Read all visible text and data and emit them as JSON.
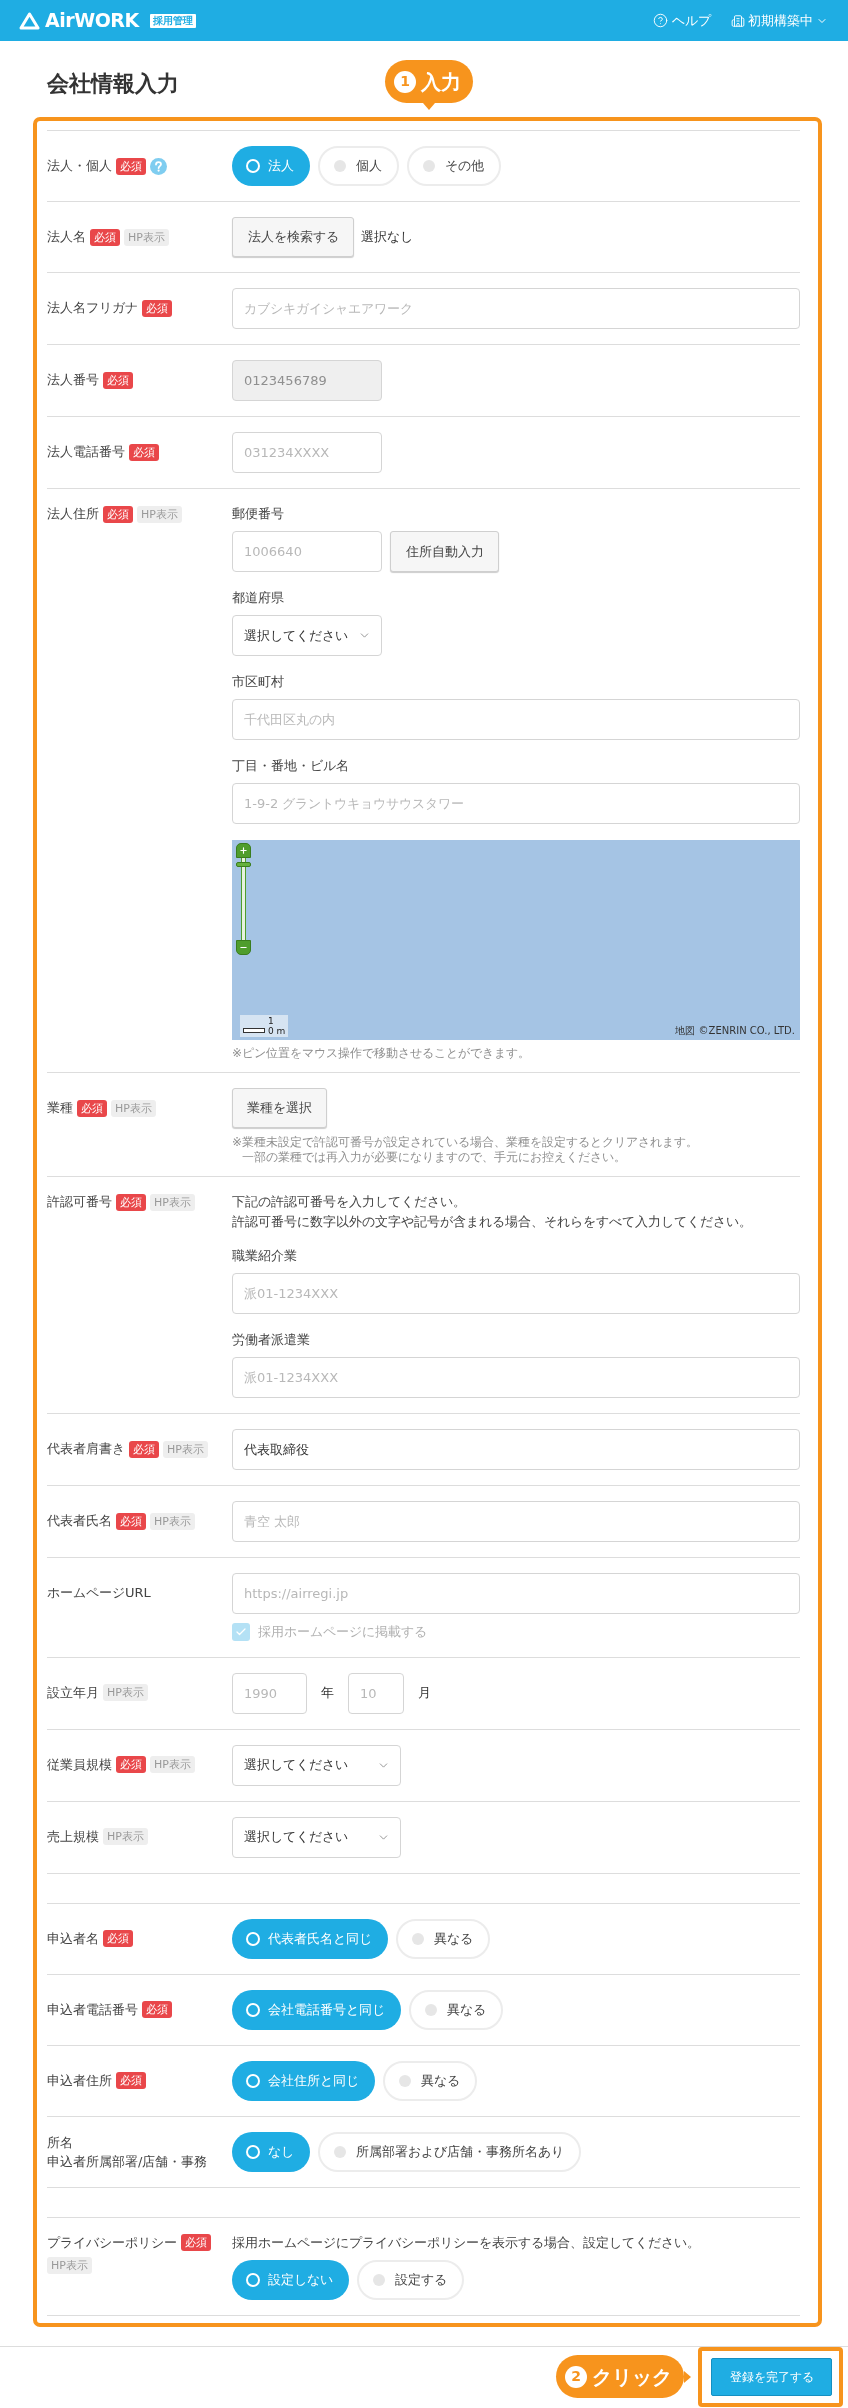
{
  "header": {
    "logo": "AirWORK",
    "logo_badge": "採用管理",
    "help": "ヘルプ",
    "status": "初期構築中"
  },
  "page_title": "会社情報入力",
  "callouts": [
    {
      "number": "1",
      "label": "入力"
    },
    {
      "number": "2",
      "label": "クリック"
    }
  ],
  "sections": [
    {
      "rows": [
        {
          "label": "法人・個人",
          "badges": [
            {
              "kind": "required",
              "text": "必須"
            }
          ],
          "help": true,
          "kind": "radio",
          "options": [
            {
              "label": "法人",
              "selected": true
            },
            {
              "label": "個人",
              "selected": false
            },
            {
              "label": "その他",
              "selected": false
            }
          ]
        },
        {
          "label": "法人名",
          "badges": [
            {
              "kind": "required",
              "text": "必須"
            },
            {
              "kind": "hp",
              "text": "HP表示"
            }
          ],
          "kind": "search",
          "button": "法人を検索する",
          "status": "選択なし"
        },
        {
          "label": "法人名フリガナ",
          "badges": [
            {
              "kind": "required",
              "text": "必須"
            }
          ],
          "kind": "text",
          "placeholder": "カブシキガイシャエアワーク",
          "disabled": false
        },
        {
          "label": "法人番号",
          "badges": [
            {
              "kind": "required",
              "text": "必須"
            }
          ],
          "kind": "shorttext",
          "placeholder": "0123456789",
          "disabled": true
        },
        {
          "label": "法人電話番号",
          "badges": [
            {
              "kind": "required",
              "text": "必須"
            }
          ],
          "kind": "shorttext",
          "placeholder": "031234XXXX",
          "disabled": false
        },
        {
          "label": "法人住所",
          "badges": [
            {
              "kind": "required",
              "text": "必須"
            },
            {
              "kind": "hp",
              "text": "HP表示"
            }
          ],
          "kind": "address",
          "fields": [
            {
              "kind": "postal",
              "label": "郵便番号",
              "placeholder": "1006640",
              "button": "住所自動入力"
            },
            {
              "kind": "select",
              "label": "都道府県",
              "value": "選択してください"
            },
            {
              "kind": "text",
              "label": "市区町村",
              "placeholder": "千代田区丸の内"
            },
            {
              "kind": "text",
              "label": "丁目・番地・ビル名",
              "placeholder": "1-9-2 グラントウキョウサウスタワー"
            }
          ],
          "map": {
            "zoom": {
              "level": 0.95
            },
            "scale": [
              "1",
              "0 m"
            ],
            "attribution": "地図 ©ZENRIN CO., LTD."
          },
          "note": "※ピン位置をマウス操作で移動させることができます。"
        },
        {
          "label": "業種",
          "badges": [
            {
              "kind": "required",
              "text": "必須"
            },
            {
              "kind": "hp",
              "text": "HP表示"
            }
          ],
          "kind": "button",
          "button": "業種を選択",
          "notes": [
            "※業種未設定で許認可番号が設定されている場合、業種を設定するとクリアされます。",
            "一部の業種では再入力が必要になりますので、手元にお控えください。"
          ]
        },
        {
          "label": "許認可番号",
          "badges": [
            {
              "kind": "required",
              "text": "必須"
            },
            {
              "kind": "hp",
              "text": "HP表示"
            }
          ],
          "kind": "license",
          "description": [
            "下記の許認可番号を入力してください。",
            "許認可番号に数字以外の文字や記号が含まれる場合、それらをすべて入力してください。"
          ],
          "fields": [
            {
              "label": "職業紹介業",
              "placeholder": "派01-1234XXX"
            },
            {
              "label": "労働者派遣業",
              "placeholder": "派01-1234XXX"
            }
          ]
        },
        {
          "label": "代表者肩書き",
          "badges": [
            {
              "kind": "required",
              "text": "必須"
            },
            {
              "kind": "hp",
              "text": "HP表示"
            }
          ],
          "kind": "text",
          "value": "代表取締役",
          "disabled": false
        },
        {
          "label": "代表者氏名",
          "badges": [
            {
              "kind": "required",
              "text": "必須"
            },
            {
              "kind": "hp",
              "text": "HP表示"
            }
          ],
          "kind": "text",
          "placeholder": "青空 太郎",
          "disabled": false
        },
        {
          "label": "ホームページURL",
          "kind": "url",
          "placeholder": "https://airregi.jp",
          "checkbox": {
            "label": "採用ホームページに掲載する",
            "checked": true,
            "disabled": true
          }
        },
        {
          "label": "設立年月",
          "badges": [
            {
              "kind": "hp",
              "text": "HP表示"
            }
          ],
          "kind": "date",
          "parts": [
            {
              "placeholder": "1990",
              "unit": "年"
            },
            {
              "placeholder": "10",
              "unit": "月"
            }
          ]
        },
        {
          "label": "従業員規模",
          "badges": [
            {
              "kind": "required",
              "text": "必須"
            },
            {
              "kind": "hp",
              "text": "HP表示"
            }
          ],
          "kind": "select",
          "value": "選択してください"
        },
        {
          "label": "売上規模",
          "badges": [
            {
              "kind": "hp",
              "text": "HP表示"
            }
          ],
          "kind": "select",
          "value": "選択してください"
        }
      ]
    },
    {
      "rows": [
        {
          "label": "申込者名",
          "badges": [
            {
              "kind": "required",
              "text": "必須"
            }
          ],
          "kind": "radio",
          "options": [
            {
              "label": "代表者氏名と同じ",
              "selected": true
            },
            {
              "label": "異なる",
              "selected": false
            }
          ]
        },
        {
          "label": "申込者電話番号",
          "badges": [
            {
              "kind": "required",
              "text": "必須"
            }
          ],
          "kind": "radio",
          "options": [
            {
              "label": "会社電話番号と同じ",
              "selected": true
            },
            {
              "label": "異なる",
              "selected": false
            }
          ]
        },
        {
          "label": "申込者住所",
          "badges": [
            {
              "kind": "required",
              "text": "必須"
            }
          ],
          "kind": "radio",
          "options": [
            {
              "label": "会社住所と同じ",
              "selected": true
            },
            {
              "label": "異なる",
              "selected": false
            }
          ]
        },
        {
          "label_lines": [
            "所名",
            "申込者所属部署/店舗・事務"
          ],
          "kind": "radio",
          "options": [
            {
              "label": "なし",
              "selected": true
            },
            {
              "label": "所属部署および店舗・事務所名あり",
              "selected": false
            }
          ]
        }
      ]
    },
    {
      "rows": [
        {
          "label": "プライバシーポリシー",
          "badges": [
            {
              "kind": "required",
              "text": "必須"
            },
            {
              "kind": "hp",
              "text": "HP表示"
            }
          ],
          "kind": "radio",
          "description": "採用ホームページにプライバシーポリシーを表示する場合、設定してください。",
          "options": [
            {
              "label": "設定しない",
              "selected": true
            },
            {
              "label": "設定する",
              "selected": false
            }
          ]
        }
      ]
    }
  ],
  "submit": {
    "label": "登録を完了する"
  }
}
